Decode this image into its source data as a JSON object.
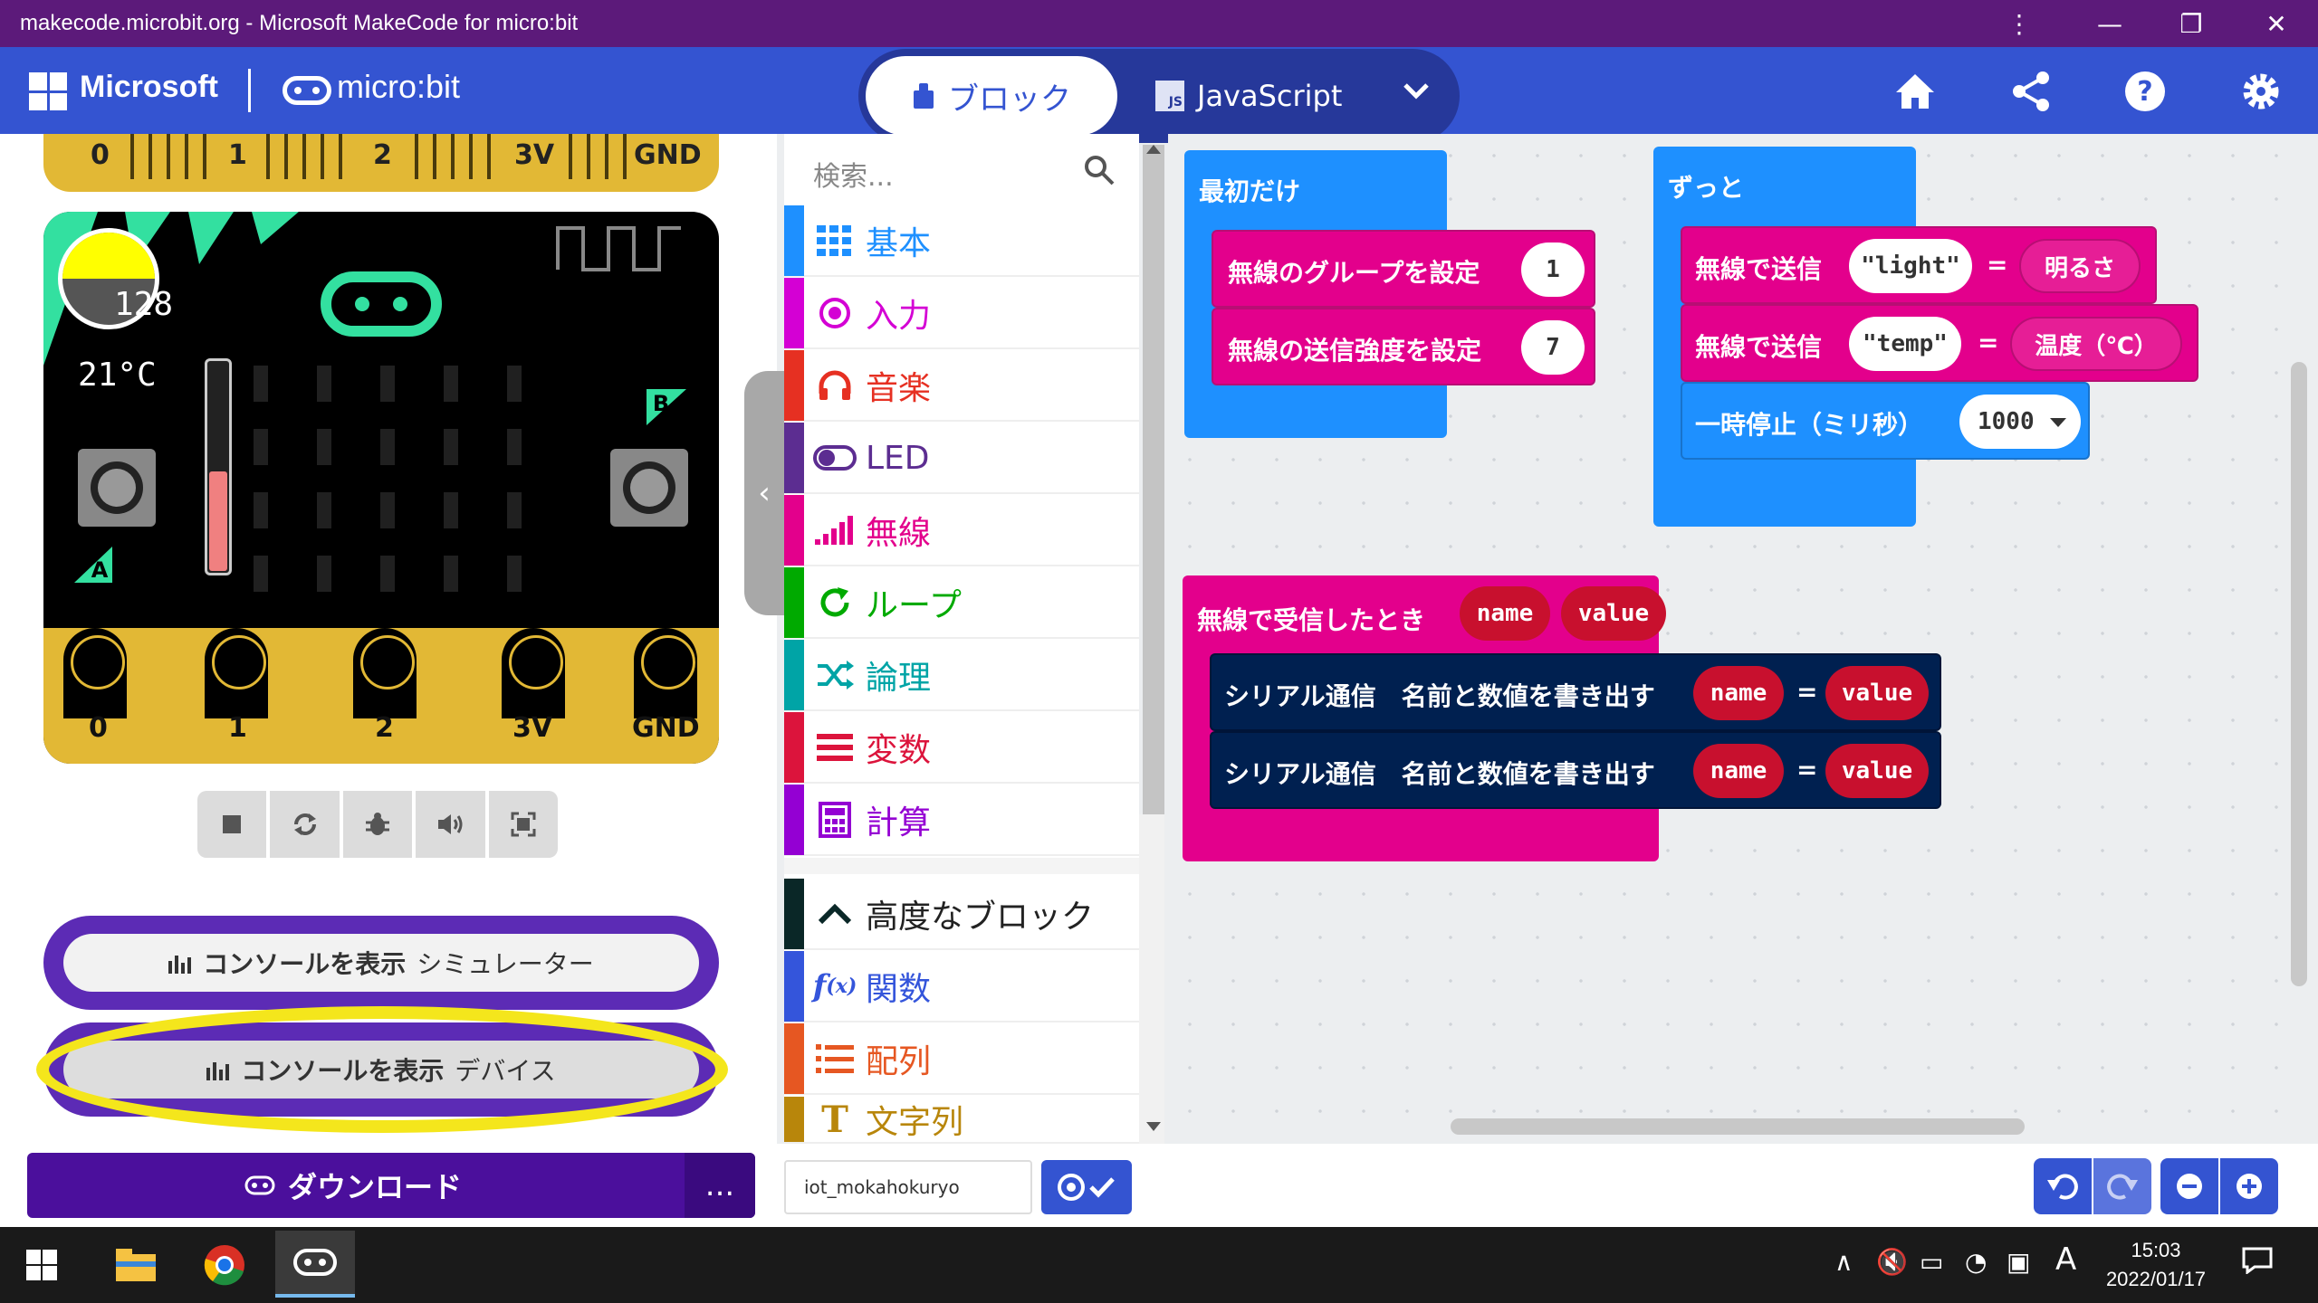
{
  "window": {
    "title": "makecode.microbit.org - Microsoft MakeCode for micro:bit"
  },
  "header": {
    "brand": "Microsoft",
    "product": "micro:bit",
    "tabs": {
      "blocks": "ブロック",
      "javascript": "JavaScript",
      "js_badge": "JS"
    }
  },
  "simulator": {
    "light_level": "128",
    "temperature": "21°C",
    "pins": [
      "0",
      "1",
      "2",
      "3V",
      "GND"
    ],
    "button_a": "A",
    "button_b": "B",
    "console_simulator": {
      "bold": "コンソールを表示",
      "rest": "シミュレーター"
    },
    "console_device": {
      "bold": "コンソールを表示",
      "rest": "デバイス"
    },
    "download_label": "ダウンロード",
    "more_label": "..."
  },
  "toolbox": {
    "search_placeholder": "検索...",
    "categories": [
      {
        "label": "基本",
        "color": "#1e90ff"
      },
      {
        "label": "入力",
        "color": "#d400d4"
      },
      {
        "label": "音楽",
        "color": "#e63022"
      },
      {
        "label": "LED",
        "color": "#5c2d91"
      },
      {
        "label": "無線",
        "color": "#e3008c"
      },
      {
        "label": "ループ",
        "color": "#00aa00"
      },
      {
        "label": "論理",
        "color": "#00a4a6"
      },
      {
        "label": "変数",
        "color": "#dc143c"
      },
      {
        "label": "計算",
        "color": "#9400d3"
      },
      {
        "label": "高度なブロック",
        "color": "#0a2727"
      },
      {
        "label": "関数",
        "color": "#3455db"
      },
      {
        "label": "配列",
        "color": "#e65722"
      },
      {
        "label": "文字列",
        "color": "#b8860b"
      }
    ]
  },
  "workspace": {
    "on_start": {
      "label": "最初だけ",
      "set_group": "無線のグループを設定",
      "group_value": "1",
      "set_power": "無線の送信強度を設定",
      "power_value": "7"
    },
    "forever": {
      "label": "ずっと",
      "send1": "無線で送信",
      "send1_name": "\"light\"",
      "eq": "=",
      "send1_value": "明るさ",
      "send2": "無線で送信",
      "send2_name": "\"temp\"",
      "send2_value": "温度（℃）",
      "pause": "一時停止（ミリ秒）",
      "pause_value": "1000"
    },
    "on_received": {
      "label": "無線で受信したとき",
      "param_name": "name",
      "param_value": "value",
      "serial1": "シリアル通信　名前と数値を書き出す",
      "serial2": "シリアル通信　名前と数値を書き出す",
      "arg_name": "name",
      "arg_value": "value"
    }
  },
  "bottombar": {
    "project_name": "iot_mokahokuryo"
  },
  "taskbar": {
    "time": "15:03",
    "date": "2022/01/17",
    "ime": "A"
  }
}
